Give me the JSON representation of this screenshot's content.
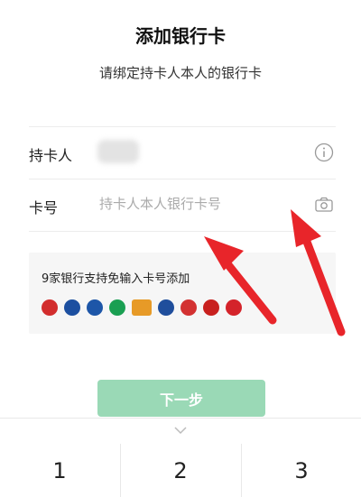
{
  "header": {
    "title": "添加银行卡",
    "subtitle": "请绑定持卡人本人的银行卡"
  },
  "form": {
    "holder_label": "持卡人",
    "holder_icon": "info-icon",
    "card_label": "卡号",
    "card_placeholder": "持卡人本人银行卡号",
    "card_value": "",
    "card_icon": "camera-icon"
  },
  "bank_panel": {
    "text": "9家银行支持免输入卡号添加",
    "logos": [
      {
        "name": "bank-logo-icbc",
        "color": "#d22d2d"
      },
      {
        "name": "bank-logo-ccb",
        "color": "#1c4fa0"
      },
      {
        "name": "bank-logo-bocom",
        "color": "#1d56a8"
      },
      {
        "name": "bank-logo-cmbc",
        "color": "#1a9f52"
      },
      {
        "name": "bank-logo-orange",
        "color": "#e79a27"
      },
      {
        "name": "bank-logo-pab",
        "color": "#1f4e9c"
      },
      {
        "name": "bank-logo-citic",
        "color": "#d33131"
      },
      {
        "name": "bank-logo-boc",
        "color": "#c8201e"
      },
      {
        "name": "bank-logo-cmb",
        "color": "#d4232a"
      }
    ]
  },
  "actions": {
    "next_label": "下一步"
  },
  "keypad": {
    "keys": [
      "1",
      "2",
      "3"
    ]
  },
  "colors": {
    "accent": "#9ad9b6",
    "annotation_arrow": "#e8252a"
  }
}
